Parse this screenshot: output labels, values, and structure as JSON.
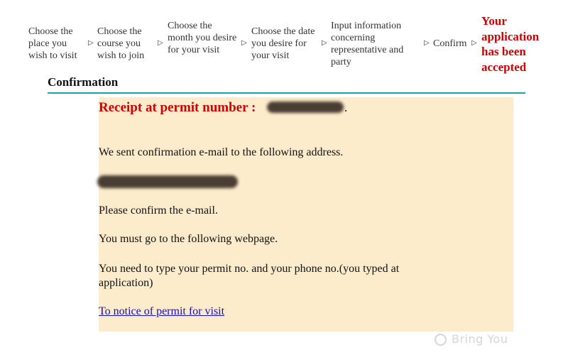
{
  "steps": [
    {
      "label": "Choose the place you wish to visit"
    },
    {
      "label": "Choose the course you wish to join"
    },
    {
      "label": "Choose the month you desire for your visit"
    },
    {
      "label": "Choose the date you desire for your visit"
    },
    {
      "label": "Input information concerning representative and party"
    },
    {
      "label": "Confirm"
    },
    {
      "label": "Your application has been accepted"
    }
  ],
  "arrow_glyph": "▷",
  "section": {
    "title": "Confirmation"
  },
  "receipt": {
    "text": "Receipt at permit number :",
    "suffix": "."
  },
  "messages": {
    "sent": "We sent confirmation e-mail to the following address.",
    "confirm": "Please confirm the e-mail.",
    "goto": "You must go to the following webpage.",
    "type": "You need to type your permit no. and your phone no.(you typed at application)"
  },
  "link": {
    "label": "To notice of permit for visit"
  },
  "watermark": {
    "text": "Bring You"
  },
  "colors": {
    "accent_red": "#cc0000",
    "rule_teal": "#1ea3a8",
    "panel_bg": "#fdeccb",
    "link_blue": "#1a0dab"
  }
}
